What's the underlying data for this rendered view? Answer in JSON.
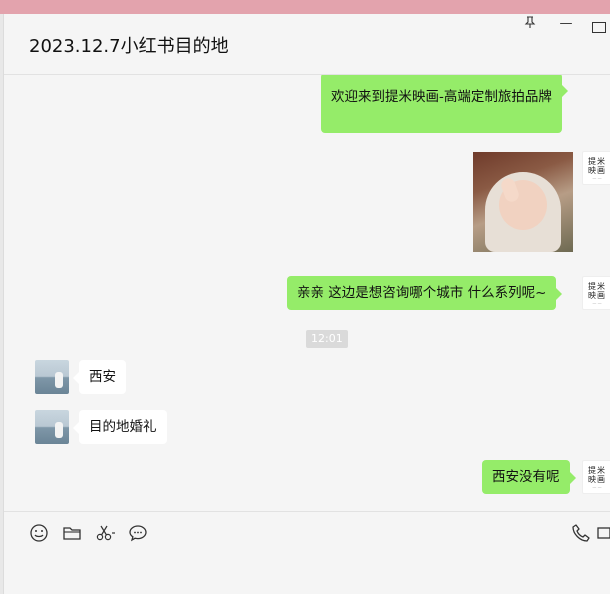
{
  "window": {
    "title": "2023.12.7小红书目的地",
    "pin_glyph": "⊥",
    "minimize_glyph": "—"
  },
  "messages": [
    {
      "side": "me",
      "type": "text",
      "text": "欢迎来到提米映画-高端定制旅拍品牌"
    },
    {
      "side": "me",
      "type": "image",
      "description_icon": "photo-sticker"
    },
    {
      "side": "me",
      "type": "text",
      "text": "亲亲  这边是想咨询哪个城市  什么系列呢~"
    },
    {
      "side": "them",
      "type": "text",
      "text": "西安"
    },
    {
      "side": "them",
      "type": "text",
      "text": "目的地婚礼"
    },
    {
      "side": "me",
      "type": "text",
      "text": "西安没有呢"
    }
  ],
  "time_divider": "12:01",
  "brand_avatar": {
    "line1": "提米",
    "line2": "映画"
  },
  "toolbar": {
    "icons": [
      "emoji-icon",
      "folder-icon",
      "scissors-icon",
      "chat-bubble-icon",
      "phone-icon",
      "video-icon"
    ]
  },
  "colors": {
    "my_bubble": "#95ec69",
    "their_bubble": "#ffffff",
    "background": "#f5f5f5"
  }
}
